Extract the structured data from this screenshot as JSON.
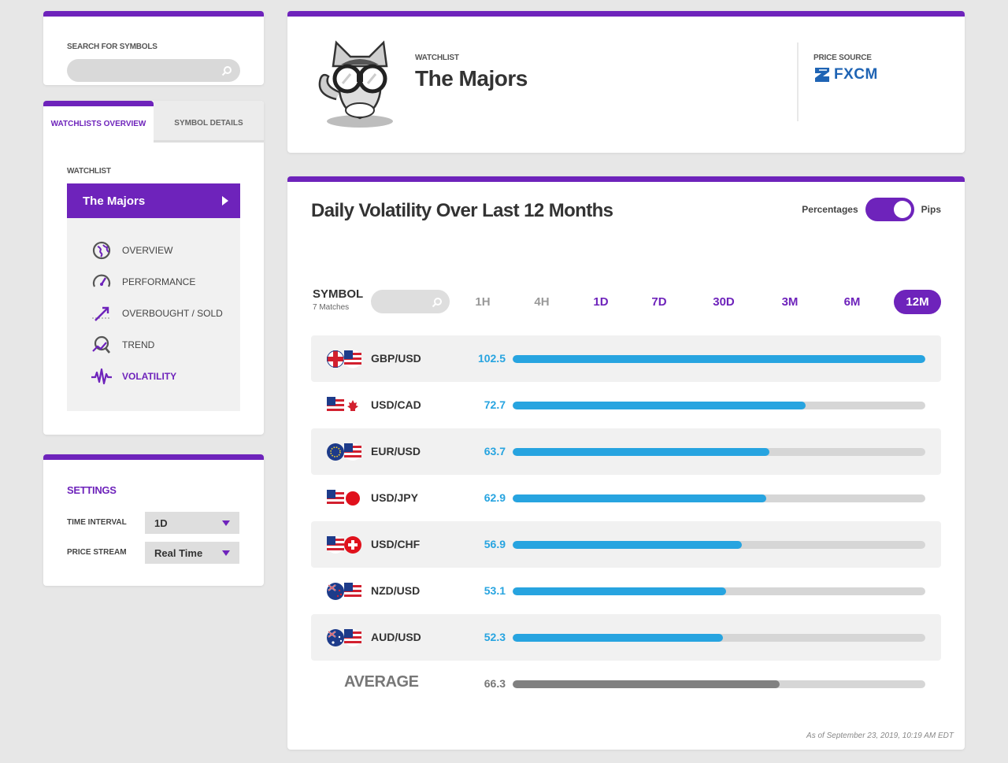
{
  "search": {
    "label": "SEARCH FOR SYMBOLS",
    "placeholder": ""
  },
  "tabs": [
    {
      "label": "WATCHLISTS OVERVIEW"
    },
    {
      "label": "SYMBOL DETAILS"
    }
  ],
  "sidebar": {
    "watchlist_label": "WATCHLIST",
    "watchlist_name": "The Majors",
    "items": [
      {
        "label": "OVERVIEW",
        "icon": "globe-icon"
      },
      {
        "label": "PERFORMANCE",
        "icon": "speedometer-icon"
      },
      {
        "label": "OVERBOUGHT / SOLD",
        "icon": "trend-arrow-icon"
      },
      {
        "label": "TREND",
        "icon": "magnifier-trend-icon"
      },
      {
        "label": "VOLATILITY",
        "icon": "pulse-icon",
        "active": true
      }
    ]
  },
  "settings": {
    "title": "SETTINGS",
    "time_interval_label": "TIME INTERVAL",
    "time_interval_value": "1D",
    "price_stream_label": "PRICE STREAM",
    "price_stream_value": "Real Time"
  },
  "header": {
    "watchlist_small": "WATCHLIST",
    "title": "The Majors",
    "price_source_label": "PRICE SOURCE",
    "price_source_name": "FXCM"
  },
  "main": {
    "title": "Daily Volatility Over Last 12 Months",
    "toggle_left": "Percentages",
    "toggle_right": "Pips",
    "toggle_state": "Pips",
    "symbol_header": "SYMBOL",
    "matches": "7 Matches",
    "periods": [
      "1H",
      "4H",
      "1D",
      "7D",
      "30D",
      "3M",
      "6M",
      "12M"
    ],
    "selected_period": "12M",
    "rows": [
      {
        "pair": "GBP/USD",
        "value": "102.5",
        "num": 102.5
      },
      {
        "pair": "USD/CAD",
        "value": "72.7",
        "num": 72.7
      },
      {
        "pair": "EUR/USD",
        "value": "63.7",
        "num": 63.7
      },
      {
        "pair": "USD/JPY",
        "value": "62.9",
        "num": 62.9
      },
      {
        "pair": "USD/CHF",
        "value": "56.9",
        "num": 56.9
      },
      {
        "pair": "NZD/USD",
        "value": "53.1",
        "num": 53.1
      },
      {
        "pair": "AUD/USD",
        "value": "52.3",
        "num": 52.3
      }
    ],
    "average": {
      "label": "AVERAGE",
      "value": "66.3",
      "num": 66.3
    },
    "max_value": 102.5,
    "as_of": "As of September 23, 2019, 10:19 AM EDT"
  },
  "colors": {
    "accent": "#6e23bb",
    "bar": "#27a4e0",
    "average_bar": "#808080",
    "brand_fxcm": "#1f64b4"
  }
}
